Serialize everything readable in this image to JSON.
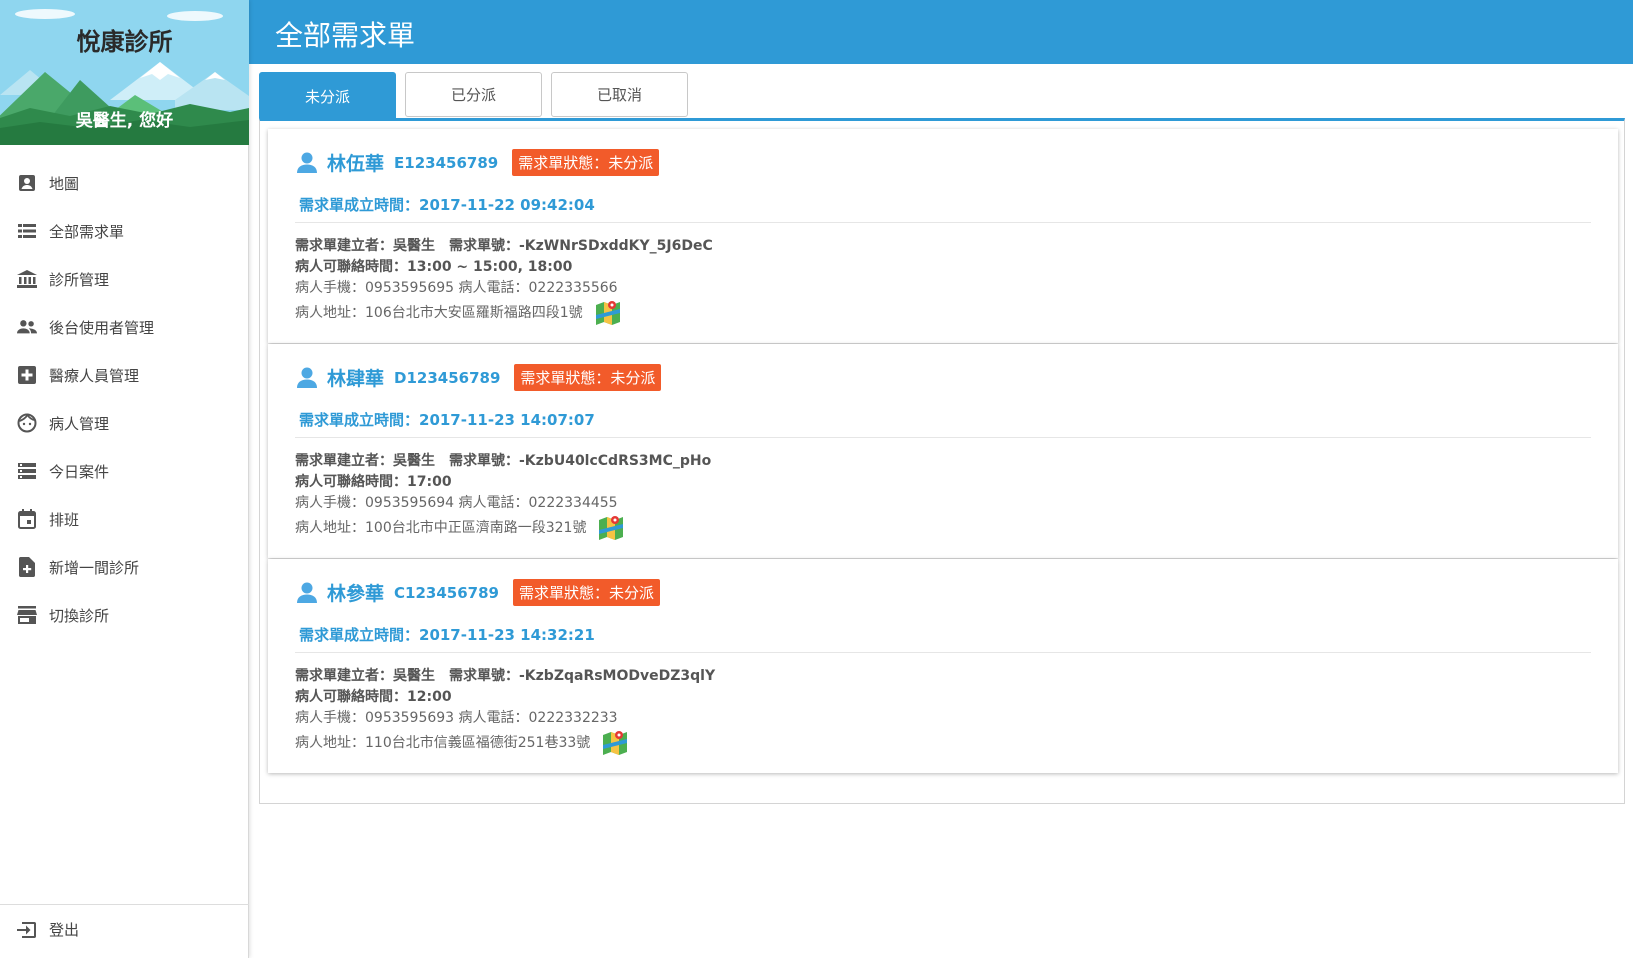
{
  "sidebar": {
    "clinic_name": "悅康診所",
    "greeting": "吳醫生, 您好",
    "items": [
      {
        "label": "地圖",
        "icon": "contact-icon"
      },
      {
        "label": "全部需求單",
        "icon": "list-icon"
      },
      {
        "label": "診所管理",
        "icon": "bank-icon"
      },
      {
        "label": "後台使用者管理",
        "icon": "people-icon"
      },
      {
        "label": "醫療人員管理",
        "icon": "medical-plus-icon"
      },
      {
        "label": "病人管理",
        "icon": "face-icon"
      },
      {
        "label": "今日案件",
        "icon": "storage-icon"
      },
      {
        "label": "排班",
        "icon": "calendar-icon"
      },
      {
        "label": "新增一間診所",
        "icon": "note-add-icon"
      },
      {
        "label": "切換診所",
        "icon": "store-icon"
      }
    ],
    "logout_label": "登出"
  },
  "header": {
    "title": "全部需求單"
  },
  "tabs": [
    {
      "label": "未分派",
      "active": true
    },
    {
      "label": "已分派",
      "active": false
    },
    {
      "label": "已取消",
      "active": false
    }
  ],
  "orders": [
    {
      "name": "林伍華",
      "id_number": "E123456789",
      "status": "需求單狀態：未分派",
      "created": "需求單成立時間：2017-11-22 09:42:04",
      "creator_order": "需求單建立者：吳醫生　需求單號：-KzWNrSDxddKY_5J6DeC",
      "contact_time": "病人可聯絡時間：13:00 ~ 15:00, 18:00",
      "phones": "病人手機：0953595695  病人電話：0222335566",
      "address": "病人地址：106台北市大安區羅斯福路四段1號"
    },
    {
      "name": "林肆華",
      "id_number": "D123456789",
      "status": "需求單狀態：未分派",
      "created": "需求單成立時間：2017-11-23 14:07:07",
      "creator_order": "需求單建立者：吳醫生　需求單號：-KzbU40lcCdRS3MC_pHo",
      "contact_time": "病人可聯絡時間：17:00",
      "phones": "病人手機：0953595694  病人電話：0222334455",
      "address": "病人地址：100台北市中正區濟南路一段321號"
    },
    {
      "name": "林參華",
      "id_number": "C123456789",
      "status": "需求單狀態：未分派",
      "created": "需求單成立時間：2017-11-23 14:32:21",
      "creator_order": "需求單建立者：吳醫生　需求單號：-KzbZqaRsMODveDZ3qlY",
      "contact_time": "病人可聯絡時間：12:00",
      "phones": "病人手機：0953595693  病人電話：0222332233",
      "address": "病人地址：110台北市信義區福德街251巷33號"
    }
  ],
  "colors": {
    "primary": "#2f9ad6",
    "badge": "#f25b2a"
  }
}
